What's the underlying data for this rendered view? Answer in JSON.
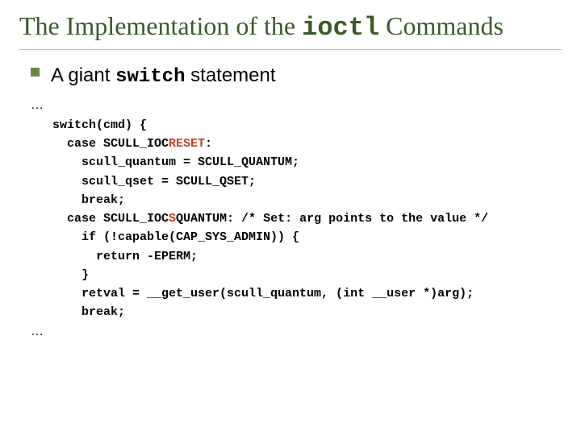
{
  "title": {
    "pre": "The Implementation of the ",
    "code": "ioctl",
    "post": " Commands"
  },
  "bullet": {
    "pre": "A giant ",
    "code": "switch",
    "post": " statement"
  },
  "code": {
    "el1": "…",
    "l1": "   switch(cmd) {",
    "l2a": "     case SCULL_IOC",
    "l2b": "RESET",
    "l2c": ":",
    "l3": "       scull_quantum = SCULL_QUANTUM;",
    "l4": "       scull_qset = SCULL_QSET;",
    "l5": "       break;",
    "l6a": "     case SCULL_IOC",
    "l6b": "S",
    "l6c": "QUANTUM: /* Set: arg points to the value */",
    "l7": "       if (!capable(CAP_SYS_ADMIN)) {",
    "l8": "         return -EPERM;",
    "l9": "       }",
    "l10": "       retval = __get_user(scull_quantum, (int __user *)arg);",
    "l11": "       break;",
    "el2": "…"
  }
}
